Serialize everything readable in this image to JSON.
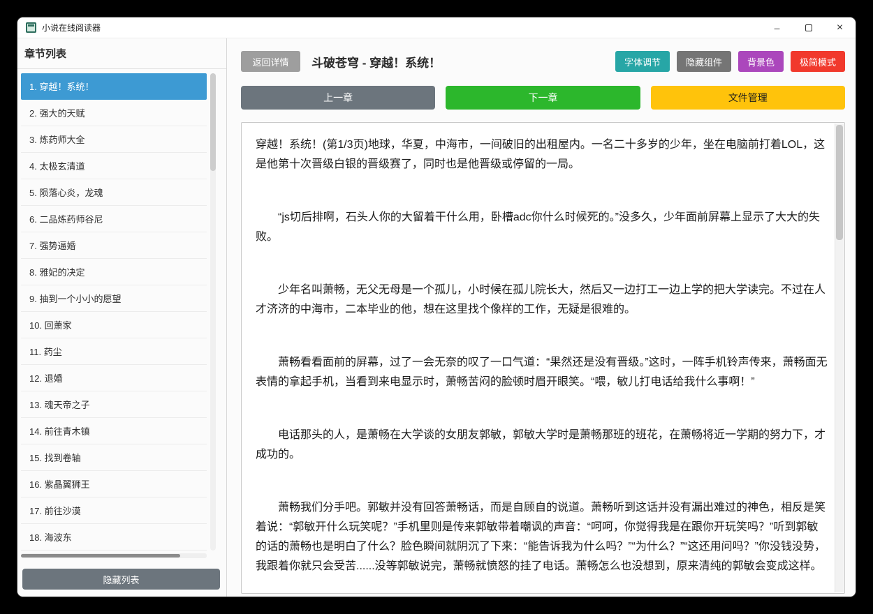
{
  "window": {
    "title": "小说在线阅读器",
    "controls": {
      "minimize": "–",
      "close": "×"
    }
  },
  "colors": {
    "selected_chapter": "#3d9ad3",
    "btn_back": "#9e9e9e",
    "btn_font": "#27a6a6",
    "btn_hide_widgets": "#757575",
    "btn_bg": "#ab47bc",
    "btn_minimal": "#f1392c",
    "btn_prev": "#6c757d",
    "btn_next": "#2cb72c",
    "btn_file": "#ffc30b",
    "btn_hide_list": "#6c757d"
  },
  "sidebar": {
    "header": "章节列表",
    "hide_list_label": "隐藏列表",
    "chapters": [
      "1. 穿越！系统！",
      "2. 强大的天赋",
      "3. 炼药师大全",
      "4. 太极玄清道",
      "5. 陨落心炎，龙魂",
      "6. 二品炼药师谷尼",
      "7. 强势逼婚",
      "8. 雅妃的决定",
      "9. 抽到一个小小的愿望",
      "10. 回萧家",
      "11. 药尘",
      "12. 退婚",
      "13. 魂天帝之子",
      "14. 前往青木镇",
      "15. 找到卷轴",
      "16. 紫晶翼狮王",
      "17. 前往沙漠",
      "18. 海波东"
    ]
  },
  "toolbar": {
    "back_label": "返回详情",
    "title": "斗破苍穹 - 穿越！系统！",
    "font_label": "字体调节",
    "hide_widgets_label": "隐藏组件",
    "bg_label": "背景色",
    "minimal_label": "极简模式"
  },
  "nav": {
    "prev_label": "上一章",
    "next_label": "下一章",
    "file_label": "文件管理"
  },
  "reader": {
    "page_info": "第1/3页",
    "paragraphs": [
      "穿越！系统！(第1/3页)地球，华夏，中海市，一间破旧的出租屋内。一名二十多岁的少年，坐在电脑前打着LOL，这是他第十次晋级白银的晋级赛了，同时也是他晋级或停留的一局。",
      "　　“js切后排啊，石头人你的大留着干什么用，卧槽adc你什么时候死的。”没多久，少年面前屏幕上显示了大大的失败。",
      "　　少年名叫萧畅，无父无母是一个孤儿，小时候在孤儿院长大，然后又一边打工一边上学的把大学读完。不过在人才济济的中海市，二本毕业的他，想在这里找个像样的工作，无疑是很难的。",
      "　　萧畅看看面前的屏幕，过了一会无奈的叹了一口气道：“果然还是没有晋级。”这时，一阵手机铃声传来，萧畅面无表情的拿起手机，当看到来电显示时，萧畅苦闷的脸顿时眉开眼笑。“喂，敏儿打电话给我什么事啊！”",
      "　　电话那头的人，是萧畅在大学谈的女朋友郭敏，郭敏大学时是萧畅那班的班花，在萧畅将近一学期的努力下，才成功的。",
      "　　萧畅我们分手吧。郭敏并没有回答萧畅话，而是自顾自的说道。萧畅听到这话并没有漏出难过的神色，相反是笑着说：“郭敏开什么玩笑呢？”手机里则是传来郭敏带着嘲讽的声音：“呵呵，你觉得我是在跟你开玩笑吗？”听到郭敏的话的萧畅也是明白了什么？脸色瞬间就阴沉了下来：“能告诉我为什么吗？”“为什么？”“这还用问吗？”你没钱没势，我跟着你就只会受苦......没等郭敏说完，萧畅就愤怒的挂了电话。萧畅怎么也没想到，原来清纯的郭敏会变成这样。"
    ]
  }
}
